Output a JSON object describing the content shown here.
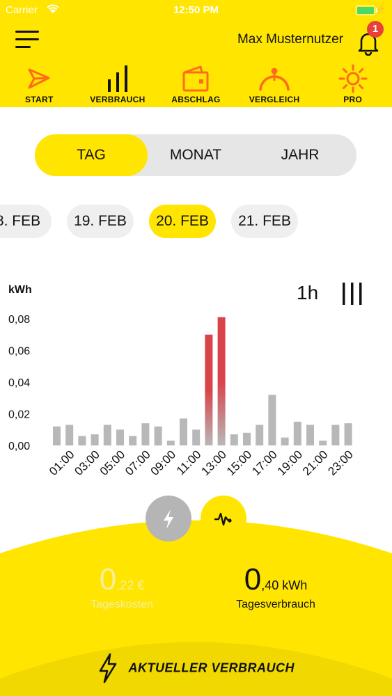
{
  "status": {
    "carrier": "Carrier",
    "time": "12:50 PM"
  },
  "header": {
    "username": "Max Musternutzer",
    "notification_count": "1"
  },
  "nav": [
    {
      "label": "START",
      "icon": "start-icon"
    },
    {
      "label": "VERBRAUCH",
      "icon": "bars-icon"
    },
    {
      "label": "ABSCHLAG",
      "icon": "wallet-icon"
    },
    {
      "label": "VERGLEICH",
      "icon": "gauge-icon"
    },
    {
      "label": "PRO",
      "icon": "sun-icon"
    }
  ],
  "segments": [
    "TAG",
    "MONAT",
    "JAHR"
  ],
  "dates": [
    "8. FEB",
    "19. FEB",
    "20. FEB",
    "21. FEB"
  ],
  "chart_unit": "kWh",
  "interval": "1h",
  "colors": {
    "accent": "#FFE500",
    "bar": "#b8b8b8",
    "peak": "#d9434a"
  },
  "chart_data": {
    "type": "bar",
    "categories": [
      "00:00",
      "01:00",
      "02:00",
      "03:00",
      "04:00",
      "05:00",
      "06:00",
      "07:00",
      "08:00",
      "09:00",
      "10:00",
      "11:00",
      "12:00",
      "13:00",
      "14:00",
      "15:00",
      "16:00",
      "17:00",
      "18:00",
      "19:00",
      "20:00",
      "21:00",
      "22:00",
      "23:00"
    ],
    "tick_labels": [
      "01:00",
      "03:00",
      "05:00",
      "07:00",
      "09:00",
      "11:00",
      "13:00",
      "15:00",
      "17:00",
      "19:00",
      "21:00",
      "23:00"
    ],
    "values": [
      0.012,
      0.013,
      0.006,
      0.007,
      0.013,
      0.01,
      0.006,
      0.014,
      0.012,
      0.003,
      0.017,
      0.01,
      0.07,
      0.081,
      0.007,
      0.008,
      0.013,
      0.032,
      0.005,
      0.015,
      0.013,
      0.003,
      0.013,
      0.014
    ],
    "y_ticks": [
      "0,00",
      "0,02",
      "0,04",
      "0,06",
      "0,08"
    ],
    "ylim": [
      0,
      0.09
    ]
  },
  "stats": {
    "cost_big": "0",
    "cost_small": ",22 €",
    "cost_label": "Tageskosten",
    "usage_big": "0",
    "usage_small": ",40 kWh",
    "usage_label": "Tagesverbrauch"
  },
  "current_label": "AKTUELLER VERBRAUCH"
}
